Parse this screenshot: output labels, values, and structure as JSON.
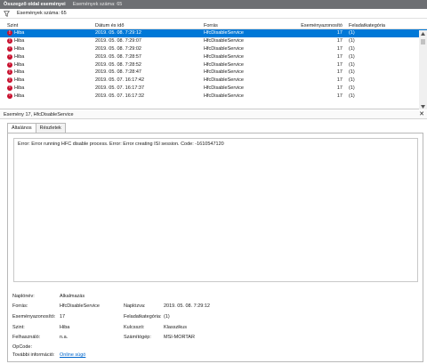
{
  "header": {
    "title": "Összegző oldal eseményei",
    "event_count": "Események száma: 65"
  },
  "filter": {
    "label": "Események száma: 65"
  },
  "table": {
    "columns": {
      "level": "Szint",
      "date": "Dátum és idő",
      "source": "Forrás",
      "event_id": "Eseményazonosító",
      "task": "Feladatkategória"
    },
    "rows": [
      {
        "level": "Hiba",
        "date": "2019. 05. 08. 7:29:12",
        "source": "HfcDisableService",
        "event_id": "17",
        "task": "(1)"
      },
      {
        "level": "Hiba",
        "date": "2019. 05. 08. 7:29:07",
        "source": "HfcDisableService",
        "event_id": "17",
        "task": "(1)"
      },
      {
        "level": "Hiba",
        "date": "2019. 05. 08. 7:29:02",
        "source": "HfcDisableService",
        "event_id": "17",
        "task": "(1)"
      },
      {
        "level": "Hiba",
        "date": "2019. 05. 08. 7:28:57",
        "source": "HfcDisableService",
        "event_id": "17",
        "task": "(1)"
      },
      {
        "level": "Hiba",
        "date": "2019. 05. 08. 7:28:52",
        "source": "HfcDisableService",
        "event_id": "17",
        "task": "(1)"
      },
      {
        "level": "Hiba",
        "date": "2019. 05. 08. 7:28:47",
        "source": "HfcDisableService",
        "event_id": "17",
        "task": "(1)"
      },
      {
        "level": "Hiba",
        "date": "2019. 05. 07. 16:17:42",
        "source": "HfcDisableService",
        "event_id": "17",
        "task": "(1)"
      },
      {
        "level": "Hiba",
        "date": "2019. 05. 07. 16:17:37",
        "source": "HfcDisableService",
        "event_id": "17",
        "task": "(1)"
      },
      {
        "level": "Hiba",
        "date": "2019. 05. 07. 16:17:32",
        "source": "HfcDisableService",
        "event_id": "17",
        "task": "(1)"
      }
    ]
  },
  "detail": {
    "header": "Esemény 17, HfcDisableService",
    "tabs": [
      "Általános",
      "Részletek"
    ],
    "message": "Error: Error running HFC disable process. Error: Error creating ISI session. Code: -1610547120",
    "props": {
      "log_name_label": "Naplónév:",
      "log_name": "Alkalmazás",
      "source_label": "Forrás:",
      "source": "HfcDisableService",
      "logged_label": "Naplózva:",
      "logged": "2019. 05. 08. 7:29:12",
      "event_id_label": "Eseményazonosító:",
      "event_id": "17",
      "task_label": "Feladatkategória:",
      "task": "(1)",
      "level_label": "Szint:",
      "level": "Hiba",
      "keywords_label": "Kulcsszó:",
      "keywords": "Klasszikus",
      "user_label": "Felhasználó:",
      "user": "n.a.",
      "computer_label": "Számítógép:",
      "computer": "MSI-MORTAR",
      "opcode_label": "OpCode:",
      "more_info_label": "További információ:",
      "more_info_link": "Online súgó"
    }
  },
  "colors": {
    "titlebar": "#6d6f73",
    "selection": "#0078d7",
    "error": "#c8102e",
    "link": "#0066cc"
  },
  "icons": {
    "filter": "funnel-icon",
    "error": "error-icon",
    "close": "close-icon"
  }
}
